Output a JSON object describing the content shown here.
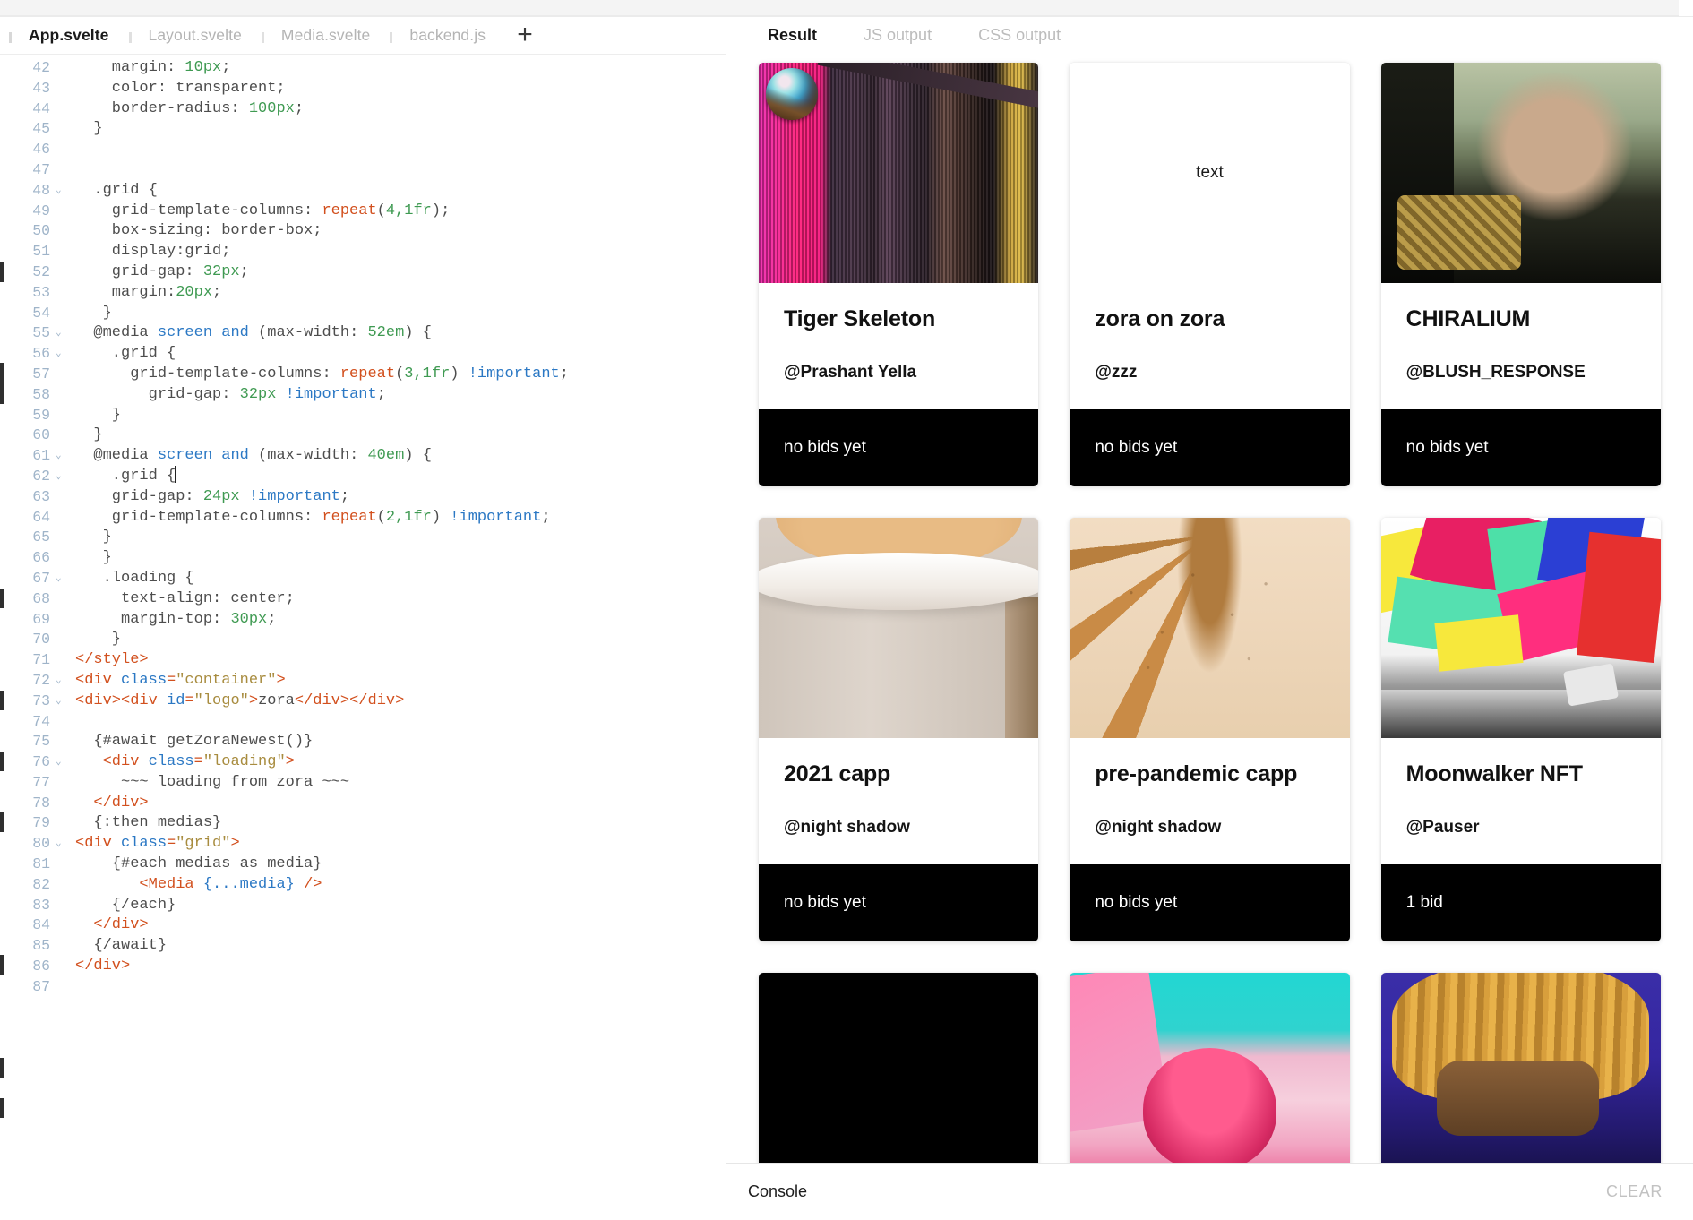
{
  "editor": {
    "tabs": [
      {
        "label": "App.svelte",
        "active": true
      },
      {
        "label": "Layout.svelte",
        "active": false
      },
      {
        "label": "Media.svelte",
        "active": false
      },
      {
        "label": "backend.js",
        "active": false
      }
    ],
    "add_tab_label": "+",
    "first_line_number": 42,
    "lines": [
      {
        "n": "42",
        "fold": "",
        "tokens": [
          {
            "t": "prop",
            "v": "    margin: "
          },
          {
            "t": "num",
            "v": "10px"
          },
          {
            "t": "punct",
            "v": ";"
          }
        ]
      },
      {
        "n": "43",
        "fold": "",
        "tokens": [
          {
            "t": "prop",
            "v": "    color: transparent;"
          }
        ]
      },
      {
        "n": "44",
        "fold": "",
        "tokens": [
          {
            "t": "prop",
            "v": "    border-radius: "
          },
          {
            "t": "num",
            "v": "100px"
          },
          {
            "t": "punct",
            "v": ";"
          }
        ]
      },
      {
        "n": "45",
        "fold": "",
        "tokens": [
          {
            "t": "plain",
            "v": "  }"
          }
        ]
      },
      {
        "n": "46",
        "fold": "",
        "tokens": [
          {
            "t": "plain",
            "v": ""
          }
        ]
      },
      {
        "n": "47",
        "fold": "",
        "tokens": [
          {
            "t": "plain",
            "v": ""
          }
        ]
      },
      {
        "n": "48",
        "fold": "v",
        "tokens": [
          {
            "t": "plain",
            "v": "  .grid {"
          }
        ]
      },
      {
        "n": "49",
        "fold": "",
        "tokens": [
          {
            "t": "prop",
            "v": "    grid-template-columns: "
          },
          {
            "t": "fn",
            "v": "repeat"
          },
          {
            "t": "punct",
            "v": "("
          },
          {
            "t": "num",
            "v": "4,1fr"
          },
          {
            "t": "punct",
            "v": ");"
          }
        ]
      },
      {
        "n": "50",
        "fold": "",
        "tokens": [
          {
            "t": "prop",
            "v": "    box-sizing: border-box;"
          }
        ]
      },
      {
        "n": "51",
        "fold": "",
        "tokens": [
          {
            "t": "prop",
            "v": "    display:grid;"
          }
        ]
      },
      {
        "n": "52",
        "fold": "",
        "tokens": [
          {
            "t": "prop",
            "v": "    grid-gap: "
          },
          {
            "t": "num",
            "v": "32px"
          },
          {
            "t": "punct",
            "v": ";"
          }
        ]
      },
      {
        "n": "53",
        "fold": "",
        "tokens": [
          {
            "t": "prop",
            "v": "    margin:"
          },
          {
            "t": "num",
            "v": "20px"
          },
          {
            "t": "punct",
            "v": ";"
          }
        ]
      },
      {
        "n": "54",
        "fold": "",
        "tokens": [
          {
            "t": "plain",
            "v": "   }"
          }
        ]
      },
      {
        "n": "55",
        "fold": "v",
        "tokens": [
          {
            "t": "plain",
            "v": "  @media "
          },
          {
            "t": "kw",
            "v": "screen and"
          },
          {
            "t": "plain",
            "v": " (max-width: "
          },
          {
            "t": "num",
            "v": "52em"
          },
          {
            "t": "plain",
            "v": ") {"
          }
        ]
      },
      {
        "n": "56",
        "fold": "v",
        "tokens": [
          {
            "t": "plain",
            "v": "    .grid {"
          }
        ]
      },
      {
        "n": "57",
        "fold": "",
        "tokens": [
          {
            "t": "prop",
            "v": "      grid-template-columns: "
          },
          {
            "t": "fn",
            "v": "repeat"
          },
          {
            "t": "punct",
            "v": "("
          },
          {
            "t": "num",
            "v": "3,1fr"
          },
          {
            "t": "punct",
            "v": ") "
          },
          {
            "t": "kw",
            "v": "!important"
          },
          {
            "t": "punct",
            "v": ";"
          }
        ]
      },
      {
        "n": "58",
        "fold": "",
        "tokens": [
          {
            "t": "prop",
            "v": "        grid-gap: "
          },
          {
            "t": "num",
            "v": "32px"
          },
          {
            "t": "plain",
            "v": " "
          },
          {
            "t": "kw",
            "v": "!important"
          },
          {
            "t": "punct",
            "v": ";"
          }
        ]
      },
      {
        "n": "59",
        "fold": "",
        "tokens": [
          {
            "t": "plain",
            "v": "    }"
          }
        ]
      },
      {
        "n": "60",
        "fold": "",
        "tokens": [
          {
            "t": "plain",
            "v": "  }"
          }
        ]
      },
      {
        "n": "61",
        "fold": "v",
        "tokens": [
          {
            "t": "plain",
            "v": "  @media "
          },
          {
            "t": "kw",
            "v": "screen and"
          },
          {
            "t": "plain",
            "v": " (max-width: "
          },
          {
            "t": "num",
            "v": "40em"
          },
          {
            "t": "plain",
            "v": ") {"
          }
        ]
      },
      {
        "n": "62",
        "fold": "v",
        "tokens": [
          {
            "t": "plain",
            "v": "    .grid {"
          },
          {
            "t": "caret",
            "v": ""
          }
        ]
      },
      {
        "n": "63",
        "fold": "",
        "tokens": [
          {
            "t": "prop",
            "v": "    grid-gap: "
          },
          {
            "t": "num",
            "v": "24px"
          },
          {
            "t": "plain",
            "v": " "
          },
          {
            "t": "kw",
            "v": "!important"
          },
          {
            "t": "punct",
            "v": ";"
          }
        ]
      },
      {
        "n": "64",
        "fold": "",
        "tokens": [
          {
            "t": "prop",
            "v": "    grid-template-columns: "
          },
          {
            "t": "fn",
            "v": "repeat"
          },
          {
            "t": "punct",
            "v": "("
          },
          {
            "t": "num",
            "v": "2,1fr"
          },
          {
            "t": "punct",
            "v": ") "
          },
          {
            "t": "kw",
            "v": "!important"
          },
          {
            "t": "punct",
            "v": ";"
          }
        ]
      },
      {
        "n": "65",
        "fold": "",
        "tokens": [
          {
            "t": "plain",
            "v": "   }"
          }
        ]
      },
      {
        "n": "66",
        "fold": "",
        "tokens": [
          {
            "t": "plain",
            "v": "   }"
          }
        ]
      },
      {
        "n": "67",
        "fold": "v",
        "tokens": [
          {
            "t": "plain",
            "v": "   .loading {"
          }
        ]
      },
      {
        "n": "68",
        "fold": "",
        "tokens": [
          {
            "t": "prop",
            "v": "     text-align: center;"
          }
        ]
      },
      {
        "n": "69",
        "fold": "",
        "tokens": [
          {
            "t": "prop",
            "v": "     margin-top: "
          },
          {
            "t": "num",
            "v": "30px"
          },
          {
            "t": "punct",
            "v": ";"
          }
        ]
      },
      {
        "n": "70",
        "fold": "",
        "tokens": [
          {
            "t": "plain",
            "v": "    }"
          }
        ]
      },
      {
        "n": "71",
        "fold": "",
        "tokens": [
          {
            "t": "tag",
            "v": "</style>"
          }
        ]
      },
      {
        "n": "72",
        "fold": "v",
        "tokens": [
          {
            "t": "tag",
            "v": "<div "
          },
          {
            "t": "attr",
            "v": "class"
          },
          {
            "t": "tag",
            "v": "="
          },
          {
            "t": "str",
            "v": "\"container\""
          },
          {
            "t": "tag",
            "v": ">"
          }
        ]
      },
      {
        "n": "73",
        "fold": "v",
        "tokens": [
          {
            "t": "tag",
            "v": "<div><div "
          },
          {
            "t": "attr",
            "v": "id"
          },
          {
            "t": "tag",
            "v": "="
          },
          {
            "t": "str",
            "v": "\"logo\""
          },
          {
            "t": "tag",
            "v": ">"
          },
          {
            "t": "plain",
            "v": "zora"
          },
          {
            "t": "tag",
            "v": "</div></div>"
          }
        ]
      },
      {
        "n": "74",
        "fold": "",
        "tokens": [
          {
            "t": "plain",
            "v": ""
          }
        ]
      },
      {
        "n": "75",
        "fold": "",
        "tokens": [
          {
            "t": "plain",
            "v": "  {#await getZoraNewest()}"
          }
        ]
      },
      {
        "n": "76",
        "fold": "v",
        "tokens": [
          {
            "t": "plain",
            "v": "   "
          },
          {
            "t": "tag",
            "v": "<div "
          },
          {
            "t": "attr",
            "v": "class"
          },
          {
            "t": "tag",
            "v": "="
          },
          {
            "t": "str",
            "v": "\"loading\""
          },
          {
            "t": "tag",
            "v": ">"
          }
        ]
      },
      {
        "n": "77",
        "fold": "",
        "tokens": [
          {
            "t": "plain",
            "v": "     ~~~ loading from zora ~~~"
          }
        ]
      },
      {
        "n": "78",
        "fold": "",
        "tokens": [
          {
            "t": "plain",
            "v": "  "
          },
          {
            "t": "tag",
            "v": "</div>"
          }
        ]
      },
      {
        "n": "79",
        "fold": "",
        "tokens": [
          {
            "t": "plain",
            "v": "  {:then medias}"
          }
        ]
      },
      {
        "n": "80",
        "fold": "v",
        "tokens": [
          {
            "t": "tag",
            "v": "<div "
          },
          {
            "t": "attr",
            "v": "class"
          },
          {
            "t": "tag",
            "v": "="
          },
          {
            "t": "str",
            "v": "\"grid\""
          },
          {
            "t": "tag",
            "v": ">"
          }
        ]
      },
      {
        "n": "81",
        "fold": "",
        "tokens": [
          {
            "t": "plain",
            "v": "    {#each medias as media}"
          }
        ]
      },
      {
        "n": "82",
        "fold": "",
        "tokens": [
          {
            "t": "plain",
            "v": "       "
          },
          {
            "t": "tag",
            "v": "<Media "
          },
          {
            "t": "attr",
            "v": "{...media}"
          },
          {
            "t": "tag",
            "v": " />"
          }
        ]
      },
      {
        "n": "83",
        "fold": "",
        "tokens": [
          {
            "t": "plain",
            "v": "    {/each}"
          }
        ]
      },
      {
        "n": "84",
        "fold": "",
        "tokens": [
          {
            "t": "plain",
            "v": "  "
          },
          {
            "t": "tag",
            "v": "</div>"
          }
        ]
      },
      {
        "n": "85",
        "fold": "",
        "tokens": [
          {
            "t": "plain",
            "v": "  {/await}"
          }
        ]
      },
      {
        "n": "86",
        "fold": "",
        "tokens": [
          {
            "t": "tag",
            "v": "</div>"
          }
        ]
      },
      {
        "n": "87",
        "fold": "",
        "tokens": [
          {
            "t": "plain",
            "v": ""
          }
        ]
      }
    ]
  },
  "result": {
    "tabs": [
      {
        "label": "Result",
        "active": true
      },
      {
        "label": "JS output",
        "active": false
      },
      {
        "label": "CSS output",
        "active": false
      }
    ],
    "cards": [
      {
        "title": "Tiger Skeleton",
        "creator": "@Prashant Yella",
        "bid": "no bids yet",
        "art": "stripes",
        "media_text": ""
      },
      {
        "title": "zora on zora",
        "creator": "@zzz",
        "bid": "no bids yet",
        "art": "plain",
        "media_text": "text"
      },
      {
        "title": "CHIRALIUM",
        "creator": "@BLUSH_RESPONSE",
        "bid": "no bids yet",
        "art": "arm",
        "media_text": ""
      },
      {
        "title": "2021 capp",
        "creator": "@night shadow",
        "bid": "no bids yet",
        "art": "cup",
        "media_text": ""
      },
      {
        "title": "pre-pandemic capp",
        "creator": "@night shadow",
        "bid": "no bids yet",
        "art": "latte",
        "media_text": ""
      },
      {
        "title": "Moonwalker NFT",
        "creator": "@Pauser",
        "bid": "1 bid",
        "art": "graffiti",
        "media_text": ""
      },
      {
        "title": "",
        "creator": "",
        "bid": "",
        "art": "black",
        "media_text": ""
      },
      {
        "title": "",
        "creator": "",
        "bid": "",
        "art": "tongue",
        "media_text": ""
      },
      {
        "title": "",
        "creator": "",
        "bid": "",
        "art": "dread",
        "media_text": ""
      }
    ]
  },
  "console": {
    "label": "Console",
    "clear_label": "CLEAR"
  },
  "colors": {
    "accent_tag": "#d2501e",
    "accent_attr": "#2b78c4",
    "accent_num": "#3f9a52",
    "accent_str": "#a88c3f",
    "bid_bar": "#000000"
  }
}
